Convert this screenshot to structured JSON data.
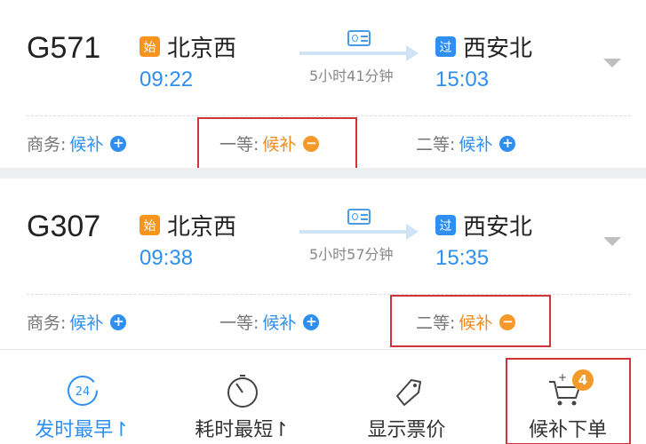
{
  "trains": [
    {
      "number": "G571",
      "from": {
        "badge": "始",
        "name": "北京西",
        "time": "09:22"
      },
      "to": {
        "badge": "过",
        "name": "西安北",
        "time": "15:03"
      },
      "duration": "5小时41分钟",
      "seats": [
        {
          "label": "商务:",
          "status": "候补",
          "action": "+"
        },
        {
          "label": "一等:",
          "status": "候补",
          "action": "−"
        },
        {
          "label": "二等:",
          "status": "候补",
          "action": "+"
        }
      ]
    },
    {
      "number": "G307",
      "from": {
        "badge": "始",
        "name": "北京西",
        "time": "09:38"
      },
      "to": {
        "badge": "过",
        "name": "西安北",
        "time": "15:35"
      },
      "duration": "5小时57分钟",
      "seats": [
        {
          "label": "商务:",
          "status": "候补",
          "action": "+"
        },
        {
          "label": "一等:",
          "status": "候补",
          "action": "+"
        },
        {
          "label": "二等:",
          "status": "候补",
          "action": "−"
        }
      ]
    }
  ],
  "toolbar": {
    "earliest": {
      "icon_text": "24",
      "label": "发时最早↾"
    },
    "shortest": {
      "label": "耗时最短↾"
    },
    "price": {
      "label": "显示票价"
    },
    "waitlist": {
      "label": "候补下单",
      "count": "4",
      "icon_plus": "+"
    }
  },
  "colors": {
    "accent": "#2e8ff0",
    "orange": "#f59a2a",
    "highlight": "#d0333a"
  }
}
